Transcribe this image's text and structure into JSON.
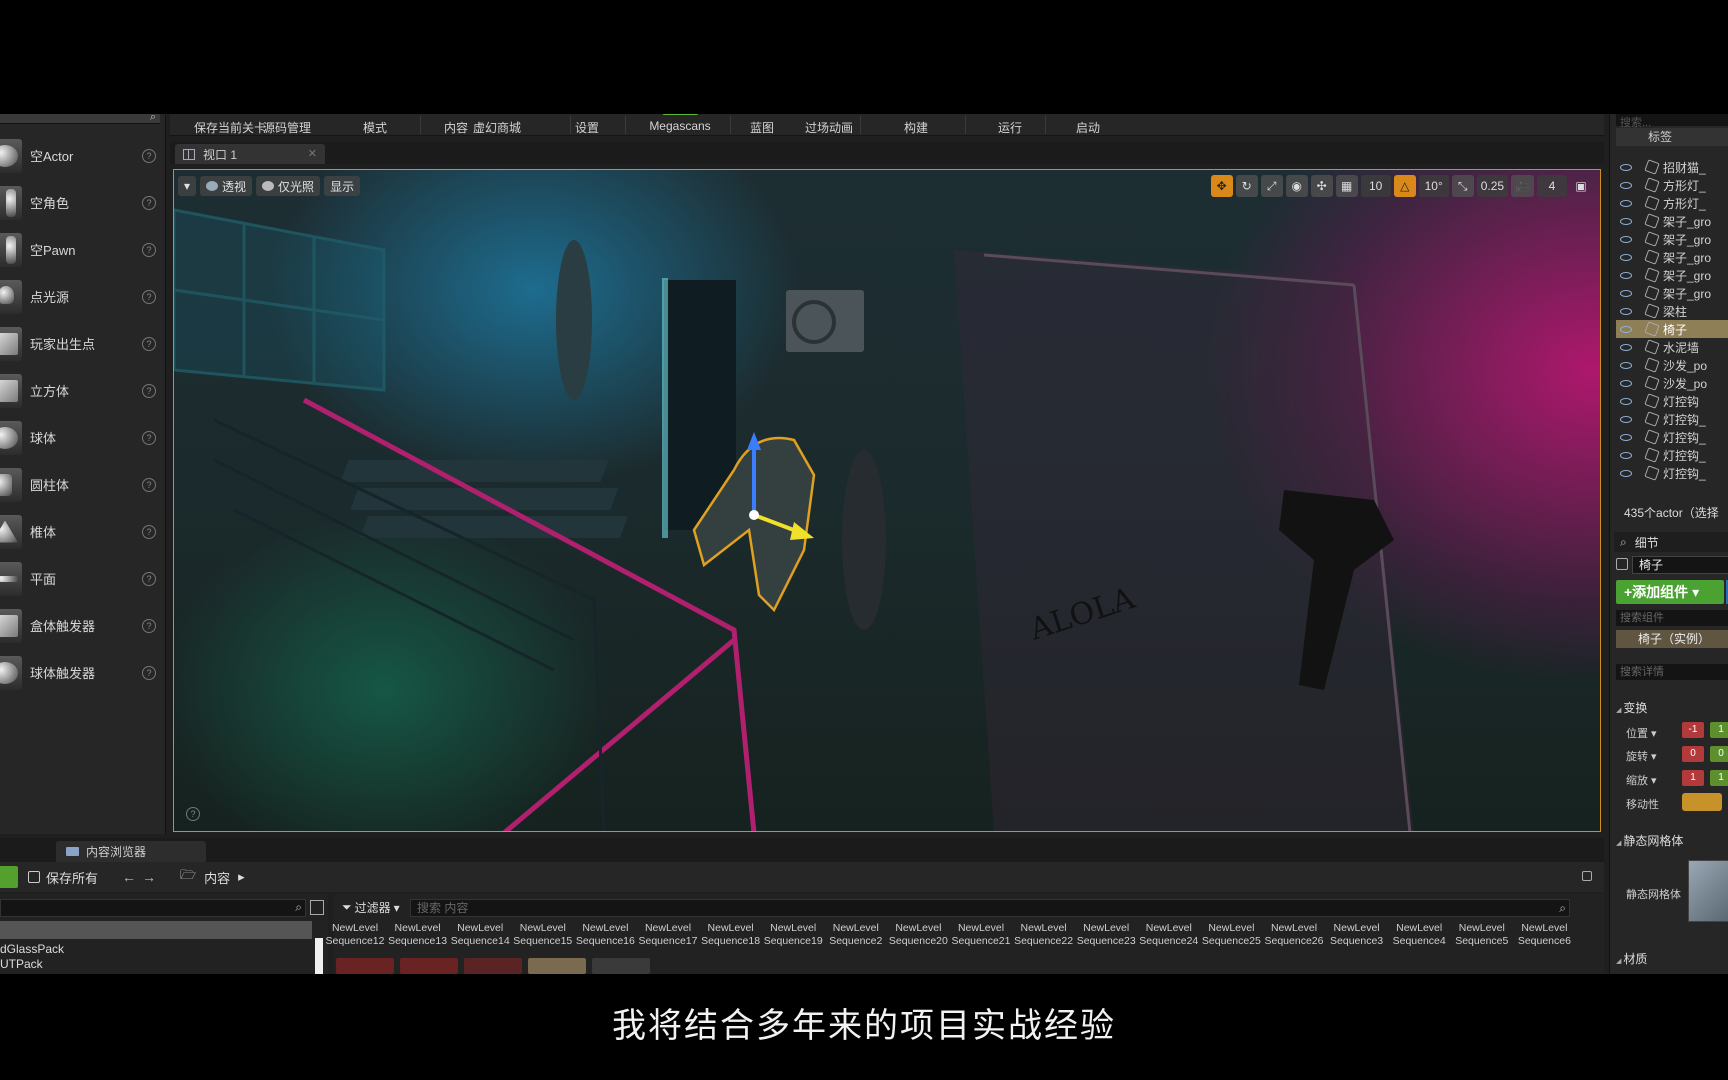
{
  "toolbar": {
    "items": [
      "保存当前关卡",
      "源码管理",
      "模式",
      "内容",
      "虚幻商城",
      "设置",
      "Megascans",
      "蓝图",
      "过场动画",
      "构建",
      "运行",
      "启动"
    ]
  },
  "place_actors": {
    "items": [
      {
        "label": "空Actor",
        "icon": "sphere-icon"
      },
      {
        "label": "空角色",
        "icon": "character-icon"
      },
      {
        "label": "空Pawn",
        "icon": "pawn-icon"
      },
      {
        "label": "点光源",
        "icon": "point-light-icon"
      },
      {
        "label": "玩家出生点",
        "icon": "player-start-icon"
      },
      {
        "label": "立方体",
        "icon": "cube-icon"
      },
      {
        "label": "球体",
        "icon": "sphere-icon"
      },
      {
        "label": "圆柱体",
        "icon": "cylinder-icon"
      },
      {
        "label": "椎体",
        "icon": "cone-icon"
      },
      {
        "label": "平面",
        "icon": "plane-icon"
      },
      {
        "label": "盒体触发器",
        "icon": "box-trigger-icon"
      },
      {
        "label": "球体触发器",
        "icon": "sphere-trigger-icon"
      }
    ]
  },
  "viewport": {
    "tab_label": "视口 1",
    "perspective_label": "透视",
    "lighting_label": "仅光照",
    "show_label": "显示",
    "grid_snap": "10",
    "rotation_snap": "10°",
    "scale_snap": "0.25",
    "camera_speed": "4"
  },
  "content_browser": {
    "tab_label": "内容浏览器",
    "save_all_label": "保存所有",
    "path_label": "内容",
    "filter_label": "过滤器",
    "search_placeholder": "搜索 内容",
    "folders": [
      "dGlassPack",
      "UTPack"
    ],
    "assets": [
      {
        "line1": "NewLevel",
        "line2": "Sequence12"
      },
      {
        "line1": "NewLevel",
        "line2": "Sequence13"
      },
      {
        "line1": "NewLevel",
        "line2": "Sequence14"
      },
      {
        "line1": "NewLevel",
        "line2": "Sequence15"
      },
      {
        "line1": "NewLevel",
        "line2": "Sequence16"
      },
      {
        "line1": "NewLevel",
        "line2": "Sequence17"
      },
      {
        "line1": "NewLevel",
        "line2": "Sequence18"
      },
      {
        "line1": "NewLevel",
        "line2": "Sequence19"
      },
      {
        "line1": "NewLevel",
        "line2": "Sequence2"
      },
      {
        "line1": "NewLevel",
        "line2": "Sequence20"
      },
      {
        "line1": "NewLevel",
        "line2": "Sequence21"
      },
      {
        "line1": "NewLevel",
        "line2": "Sequence22"
      },
      {
        "line1": "NewLevel",
        "line2": "Sequence23"
      },
      {
        "line1": "NewLevel",
        "line2": "Sequence24"
      },
      {
        "line1": "NewLevel",
        "line2": "Sequence25"
      },
      {
        "line1": "NewLevel",
        "line2": "Sequence26"
      },
      {
        "line1": "NewLevel",
        "line2": "Sequence3"
      },
      {
        "line1": "NewLevel",
        "line2": "Sequence4"
      },
      {
        "line1": "NewLevel",
        "line2": "Sequence5"
      },
      {
        "line1": "NewLevel",
        "line2": "Sequence6"
      }
    ]
  },
  "outliner": {
    "search_placeholder": "搜索...",
    "header_label": "标签",
    "rows": [
      {
        "label": "招财猫_",
        "selected": false
      },
      {
        "label": "方形灯_",
        "selected": false
      },
      {
        "label": "方形灯_",
        "selected": false
      },
      {
        "label": "架子_gro",
        "selected": false
      },
      {
        "label": "架子_gro",
        "selected": false
      },
      {
        "label": "架子_gro",
        "selected": false
      },
      {
        "label": "架子_gro",
        "selected": false
      },
      {
        "label": "架子_gro",
        "selected": false
      },
      {
        "label": "梁柱",
        "selected": false
      },
      {
        "label": "椅子",
        "selected": true
      },
      {
        "label": "水泥墙",
        "selected": false
      },
      {
        "label": "沙发_po",
        "selected": false
      },
      {
        "label": "沙发_po",
        "selected": false
      },
      {
        "label": "灯控钩",
        "selected": false
      },
      {
        "label": "灯控钩_",
        "selected": false
      },
      {
        "label": "灯控钩_",
        "selected": false
      },
      {
        "label": "灯控钩_",
        "selected": false
      },
      {
        "label": "灯控钩_",
        "selected": false
      }
    ],
    "count_label": "435个actor（选择"
  },
  "details": {
    "tab_label": "细节",
    "actor_name": "椅子",
    "add_component_label": "+添加组件 ▾",
    "component_search_placeholder": "搜索组件",
    "component_instance": "椅子（实例）",
    "detail_search_placeholder": "搜索详情",
    "transform_section": "变换",
    "location_label": "位置 ▾",
    "rotation_label": "旋转 ▾",
    "scale_label": "缩放 ▾",
    "mobility_label": "移动性",
    "static_mesh_section": "静态网格体",
    "static_mesh_label": "静态网格体",
    "materials_section": "材质"
  },
  "subtitle": "我将结合多年来的项目实战经验"
}
